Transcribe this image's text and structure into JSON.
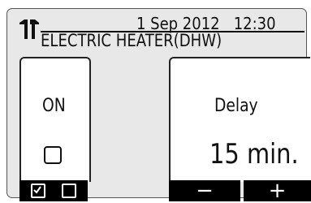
{
  "header": {
    "date": "1 Sep 2012",
    "time": "12:30",
    "title": "ELECTRIC HEATER(DHW)",
    "icon": "wrench-screwdriver-icon"
  },
  "left_panel": {
    "state_label": "ON",
    "checkbox_checked": false
  },
  "right_panel": {
    "label": "Delay",
    "value": "15 min."
  },
  "softkeys": {
    "minus": "−",
    "plus": "+"
  }
}
